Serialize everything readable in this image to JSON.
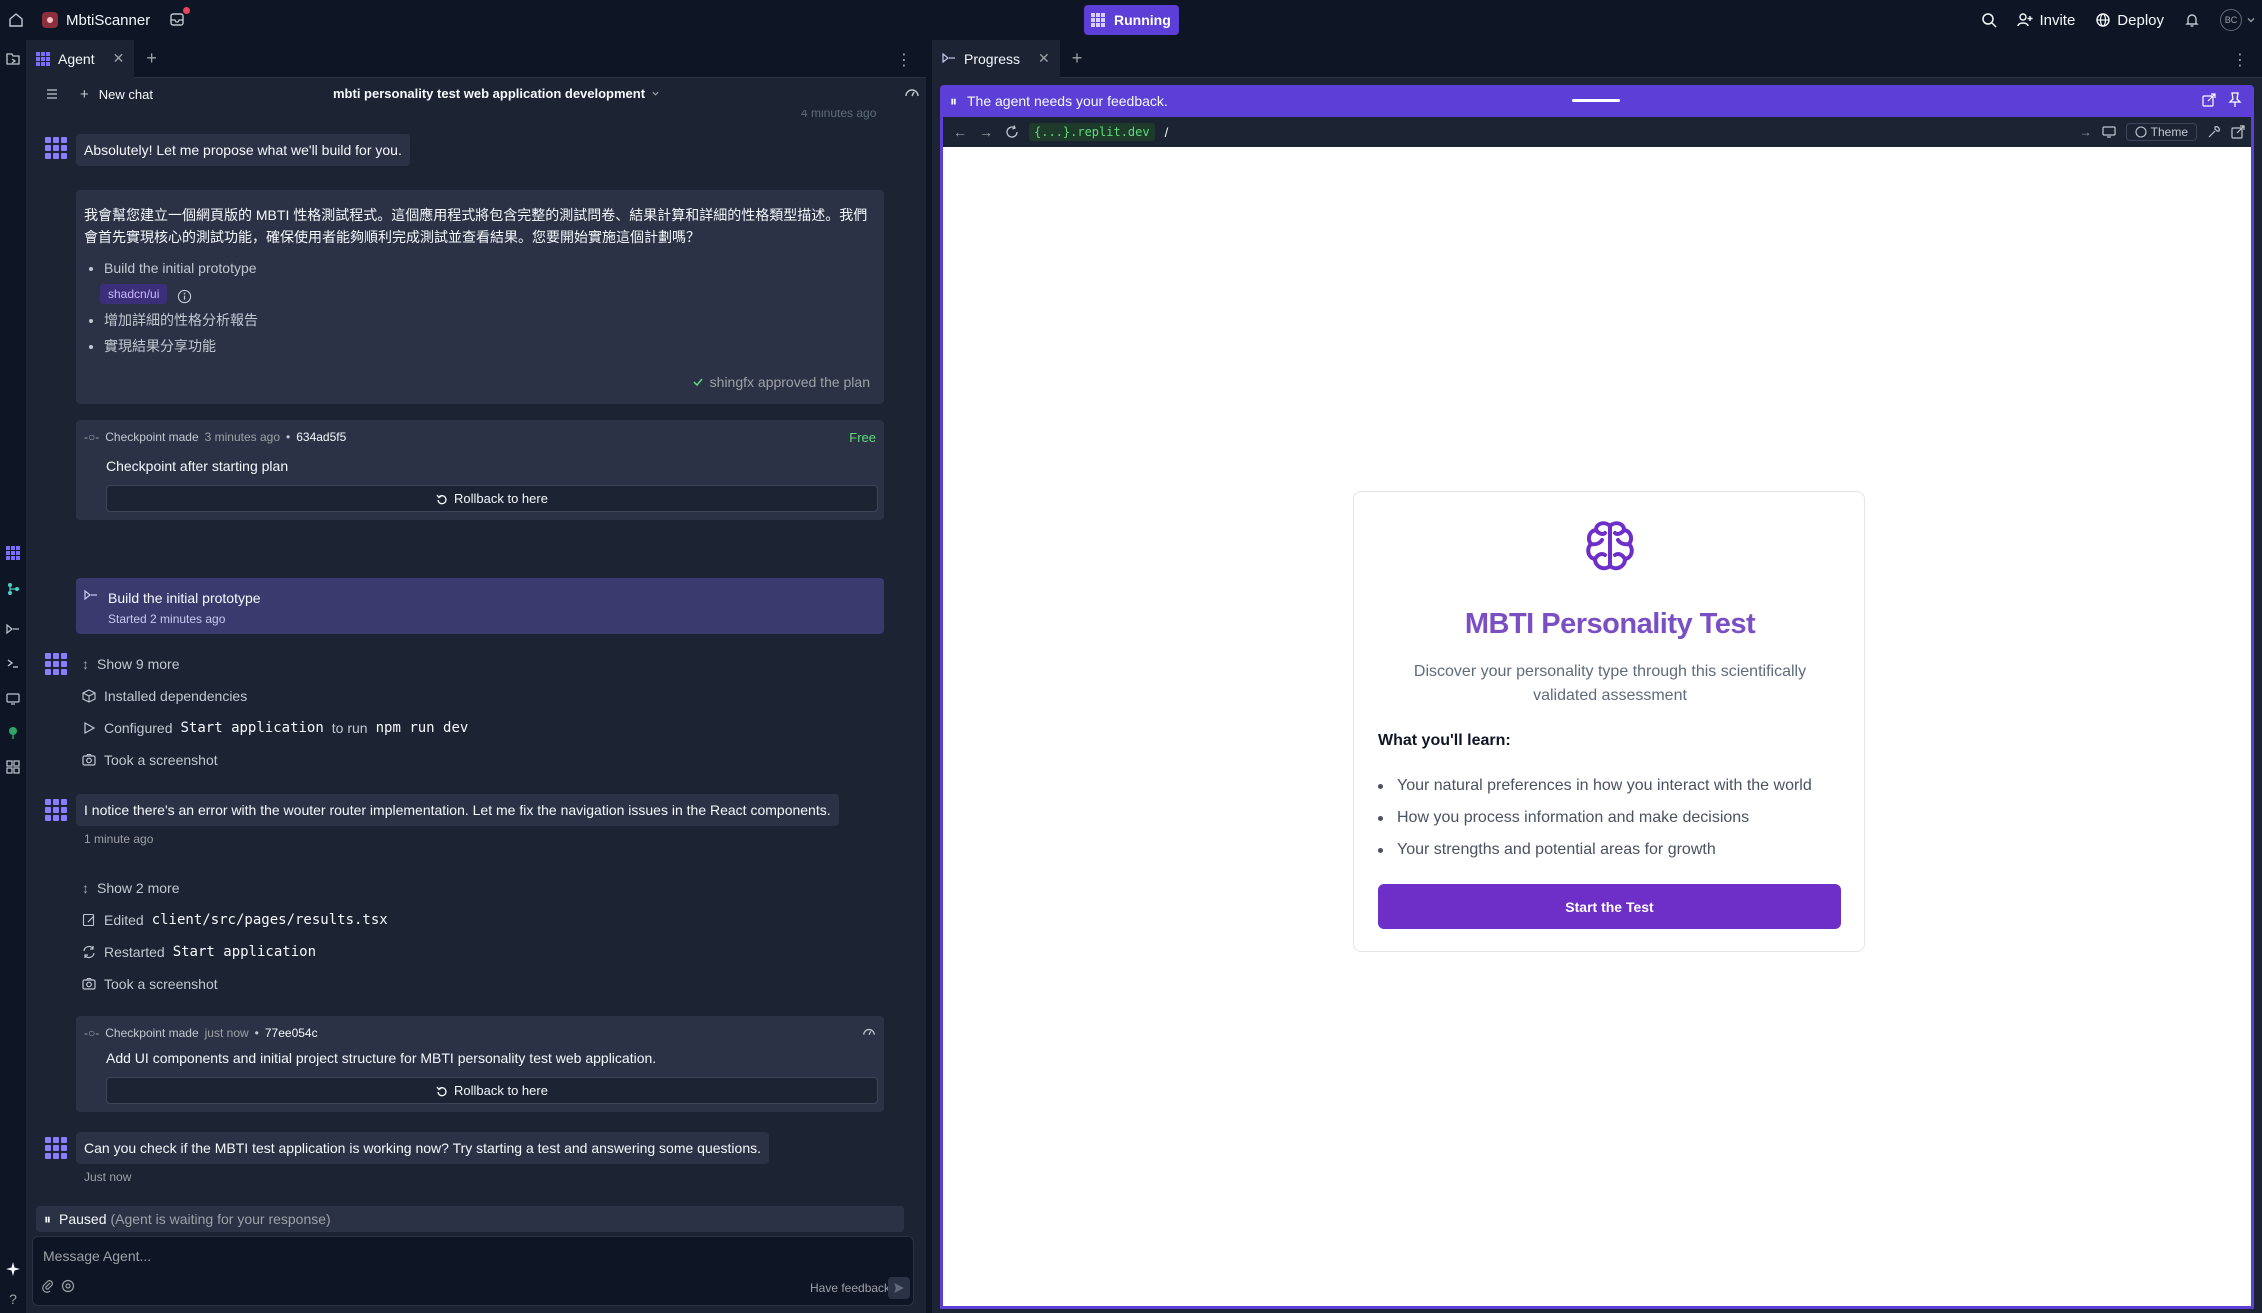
{
  "topbar": {
    "app_name": "MbtiScanner",
    "status": "Running",
    "invite": "Invite",
    "deploy": "Deploy",
    "avatar_initials": "BC"
  },
  "agent_pane": {
    "tab_label": "Agent",
    "new_chat": "New chat",
    "chat_title": "mbti personality test web application development",
    "faded_timestamp": "4 minutes ago",
    "msg1": "Absolutely! Let me propose what we'll build for you.",
    "plan": {
      "text": "我會幫您建立一個網頁版的 MBTI 性格測試程式。這個應用程式將包含完整的測試問卷、結果計算和詳細的性格類型描述。我們會首先實現核心的測試功能，確保使用者能夠順利完成測試並查看結果。您要開始實施這個計劃嗎？",
      "items": [
        "Build the initial prototype",
        "增加詳細的性格分析報告",
        "實現結果分享功能"
      ],
      "tag": "shadcn/ui",
      "approved": "shingfx approved the plan"
    },
    "checkpoint1": {
      "label": "Checkpoint made",
      "time": "3 minutes ago",
      "hash": "634ad5f5",
      "free": "Free",
      "desc": "Checkpoint after starting plan",
      "rollback": "Rollback to here"
    },
    "build": {
      "title": "Build the initial prototype",
      "started": "Started 2 minutes ago"
    },
    "group1": {
      "show_more": "Show 9 more",
      "installed": "Installed dependencies",
      "configured_prefix": "Configured",
      "configured_code1": "Start application",
      "configured_mid": "to run",
      "configured_code2": "npm run dev",
      "screenshot": "Took a screenshot"
    },
    "msg2": "I notice there's an error with the wouter router implementation. Let me fix the navigation issues in the React components.",
    "msg2_time": "1 minute ago",
    "group2": {
      "show_more": "Show 2 more",
      "edited_prefix": "Edited",
      "edited_code": "client/src/pages/results.tsx",
      "restarted_prefix": "Restarted",
      "restarted_code": "Start application",
      "screenshot": "Took a screenshot"
    },
    "checkpoint2": {
      "label": "Checkpoint made",
      "time": "just now",
      "hash": "77ee054c",
      "desc": "Add UI components and initial project structure for MBTI personality test web application.",
      "rollback": "Rollback to here"
    },
    "msg3": "Can you check if the MBTI test application is working now? Try starting a test and answering some questions.",
    "msg3_time": "Just now",
    "paused": "Paused",
    "paused_detail": "(Agent is waiting for your response)",
    "composer_placeholder": "Message Agent...",
    "feedback": "Have feedback?"
  },
  "progress_pane": {
    "tab_label": "Progress",
    "banner": "The agent needs your feedback.",
    "url_host": "{...}.replit.dev",
    "url_path": "/",
    "theme": "Theme",
    "preview": {
      "title": "MBTI Personality Test",
      "subtitle": "Discover your personality type through this scientifically validated assessment",
      "learn_heading": "What you'll learn:",
      "learn_items": [
        "Your natural preferences in how you interact with the world",
        "How you process information and make decisions",
        "Your strengths and potential areas for growth"
      ],
      "start_button": "Start the Test"
    }
  },
  "colors": {
    "accent": "#5b3fd6",
    "brand_purple": "#6d2fc8",
    "bg_dark": "#0e1525",
    "panel": "#1c2333"
  }
}
